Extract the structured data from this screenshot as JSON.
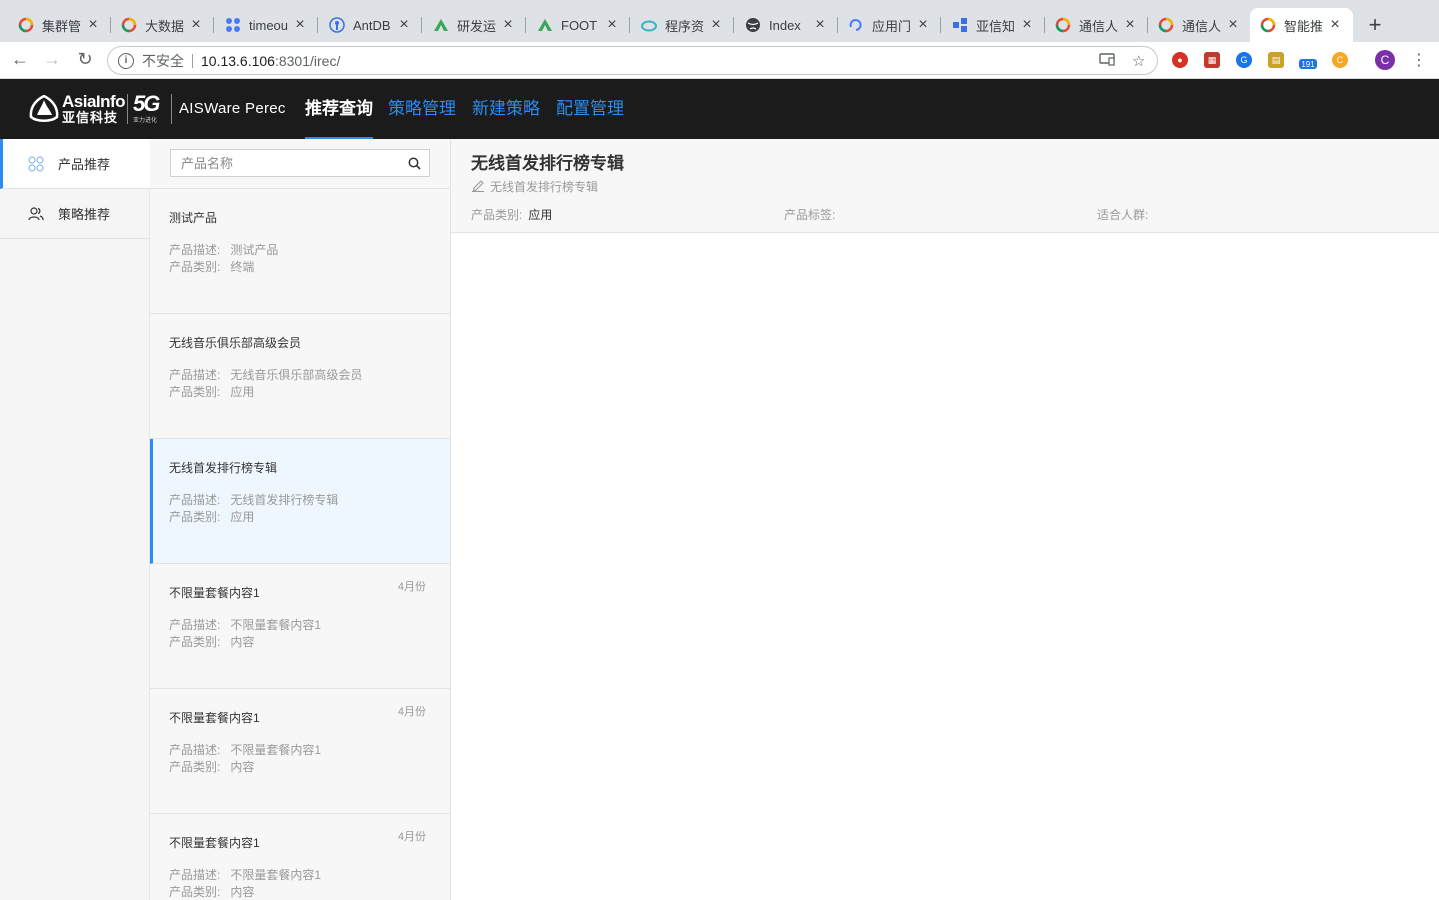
{
  "browser": {
    "tabs": [
      {
        "title": "集群管",
        "icon": "chrome-ring-icon",
        "color": "#e04b3c"
      },
      {
        "title": "大数据",
        "icon": "chrome-ring-icon",
        "color": "#e04b3c"
      },
      {
        "title": "timeou",
        "icon": "blue-dots-icon",
        "color": "#4a7bf7"
      },
      {
        "title": "AntDB",
        "icon": "antdb-icon",
        "color": "#3a6ee8"
      },
      {
        "title": "研发运",
        "icon": "triangle-logo-icon",
        "color": "#3aa657"
      },
      {
        "title": "FOOT",
        "icon": "triangle-logo-icon",
        "color": "#3aa657"
      },
      {
        "title": "程序资",
        "icon": "cloud-icon",
        "color": "#37b5c4"
      },
      {
        "title": "Index",
        "icon": "globe-icon",
        "color": "#3c4043"
      },
      {
        "title": "应用门",
        "icon": "swirl-icon",
        "color": "#4a7bf7"
      },
      {
        "title": "亚信知",
        "icon": "network-icon",
        "color": "#3a6ee8"
      },
      {
        "title": "通信人",
        "icon": "chrome-ring-icon",
        "color": "#e04b3c"
      },
      {
        "title": "通信人",
        "icon": "chrome-ring-icon",
        "color": "#e04b3c"
      },
      {
        "title": "智能推",
        "icon": "chrome-ring-icon",
        "color": "#e04b3c"
      }
    ],
    "new_tab": "+",
    "address": {
      "security_label": "不安全",
      "host": "10.13.6.106",
      "path": ":8301/irec/"
    },
    "profile_initial": "C",
    "ext_badge": "191"
  },
  "app": {
    "brand_en": "AsiaInfo",
    "brand_cn": "亚信科技",
    "brand_5g": "5G",
    "brand_5g_sub": "亚力进化",
    "product_name": "AISWare Perec",
    "nav": [
      {
        "label": "推荐查询",
        "active": true
      },
      {
        "label": "策略管理",
        "active": false
      },
      {
        "label": "新建策略",
        "active": false
      },
      {
        "label": "配置管理",
        "active": false
      }
    ]
  },
  "sidebar": {
    "items": [
      {
        "label": "产品推荐",
        "icon": "grid-dots-icon",
        "active": true
      },
      {
        "label": "策略推荐",
        "icon": "users-icon",
        "active": false
      }
    ]
  },
  "list": {
    "search_placeholder": "产品名称",
    "desc_label": "产品描述:",
    "cat_label": "产品类别:",
    "items": [
      {
        "name": "测试产品",
        "desc": "测试产品",
        "category": "终端",
        "badge": "",
        "selected": false
      },
      {
        "name": "无线音乐俱乐部高级会员",
        "desc": "无线音乐俱乐部高级会员",
        "category": "应用",
        "badge": "",
        "selected": false
      },
      {
        "name": "无线首发排行榜专辑",
        "desc": "无线首发排行榜专辑",
        "category": "应用",
        "badge": "",
        "selected": true
      },
      {
        "name": "不限量套餐内容1",
        "desc": "不限量套餐内容1",
        "category": "内容",
        "badge": "4月份",
        "selected": false
      },
      {
        "name": "不限量套餐内容1",
        "desc": "不限量套餐内容1",
        "category": "内容",
        "badge": "4月份",
        "selected": false
      },
      {
        "name": "不限量套餐内容1",
        "desc": "不限量套餐内容1",
        "category": "内容",
        "badge": "4月份",
        "selected": false
      }
    ]
  },
  "detail": {
    "title": "无线首发排行榜专辑",
    "description": "无线首发排行榜专辑",
    "category_label": "产品类别:",
    "category_value": "应用",
    "tags_label": "产品标签:",
    "tags_value": "",
    "audience_label": "适合人群:",
    "audience_value": ""
  },
  "colors": {
    "accent": "#2a8cf4",
    "header_bg": "#1b1b1b",
    "selected_bg": "#eef6fe"
  }
}
